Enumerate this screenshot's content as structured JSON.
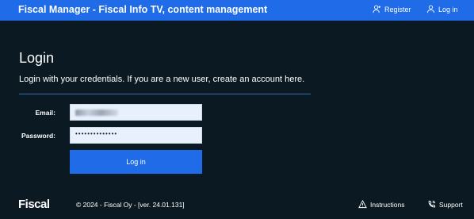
{
  "header": {
    "title": "Fiscal Manager - Fiscal Info TV, content management",
    "register_label": "Register",
    "login_label": "Log in"
  },
  "main": {
    "title": "Login",
    "intro_prefix": "Login with your credentials. If you are a new user,",
    "intro_link": "create an account here.",
    "email_label": "Email:",
    "email_value": "",
    "password_label": "Password:",
    "password_value": "••••••••••••••",
    "login_button": "Log in"
  },
  "footer": {
    "logo": "Fiscal",
    "copyright": "© 2024 - Fiscal Oy - [ver. 24.01.131]",
    "instructions_label": "Instructions",
    "support_label": "Support"
  },
  "colors": {
    "background": "#0b1a22",
    "accent": "#1f6be8",
    "input_bg": "#e8f0fe"
  },
  "icons": {
    "register": "add-user-icon",
    "login": "user-icon",
    "instructions": "warning-triangle-icon",
    "support": "phone-icon"
  }
}
